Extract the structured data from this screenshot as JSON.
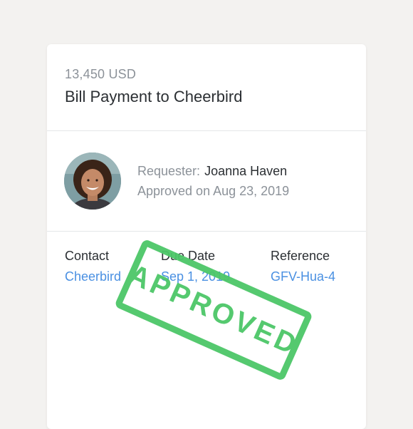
{
  "payment": {
    "amount": "13,450 USD",
    "title": "Bill Payment to Cheerbird"
  },
  "requester": {
    "label": "Requester:",
    "name": "Joanna Haven",
    "approved_text": "Approved on Aug 23, 2019"
  },
  "details": {
    "contact_label": "Contact",
    "contact_value": "Cheerbird",
    "due_label": "Due Date",
    "due_value": "Sep 1, 2019",
    "reference_label": "Reference",
    "reference_value": "GFV-Hua-4"
  },
  "stamp": {
    "text": "APPROVED",
    "color": "#4cc768"
  },
  "colors": {
    "link": "#4a90e2",
    "muted": "#8c9299",
    "text": "#2b2f33",
    "background": "#f3f2f0"
  }
}
